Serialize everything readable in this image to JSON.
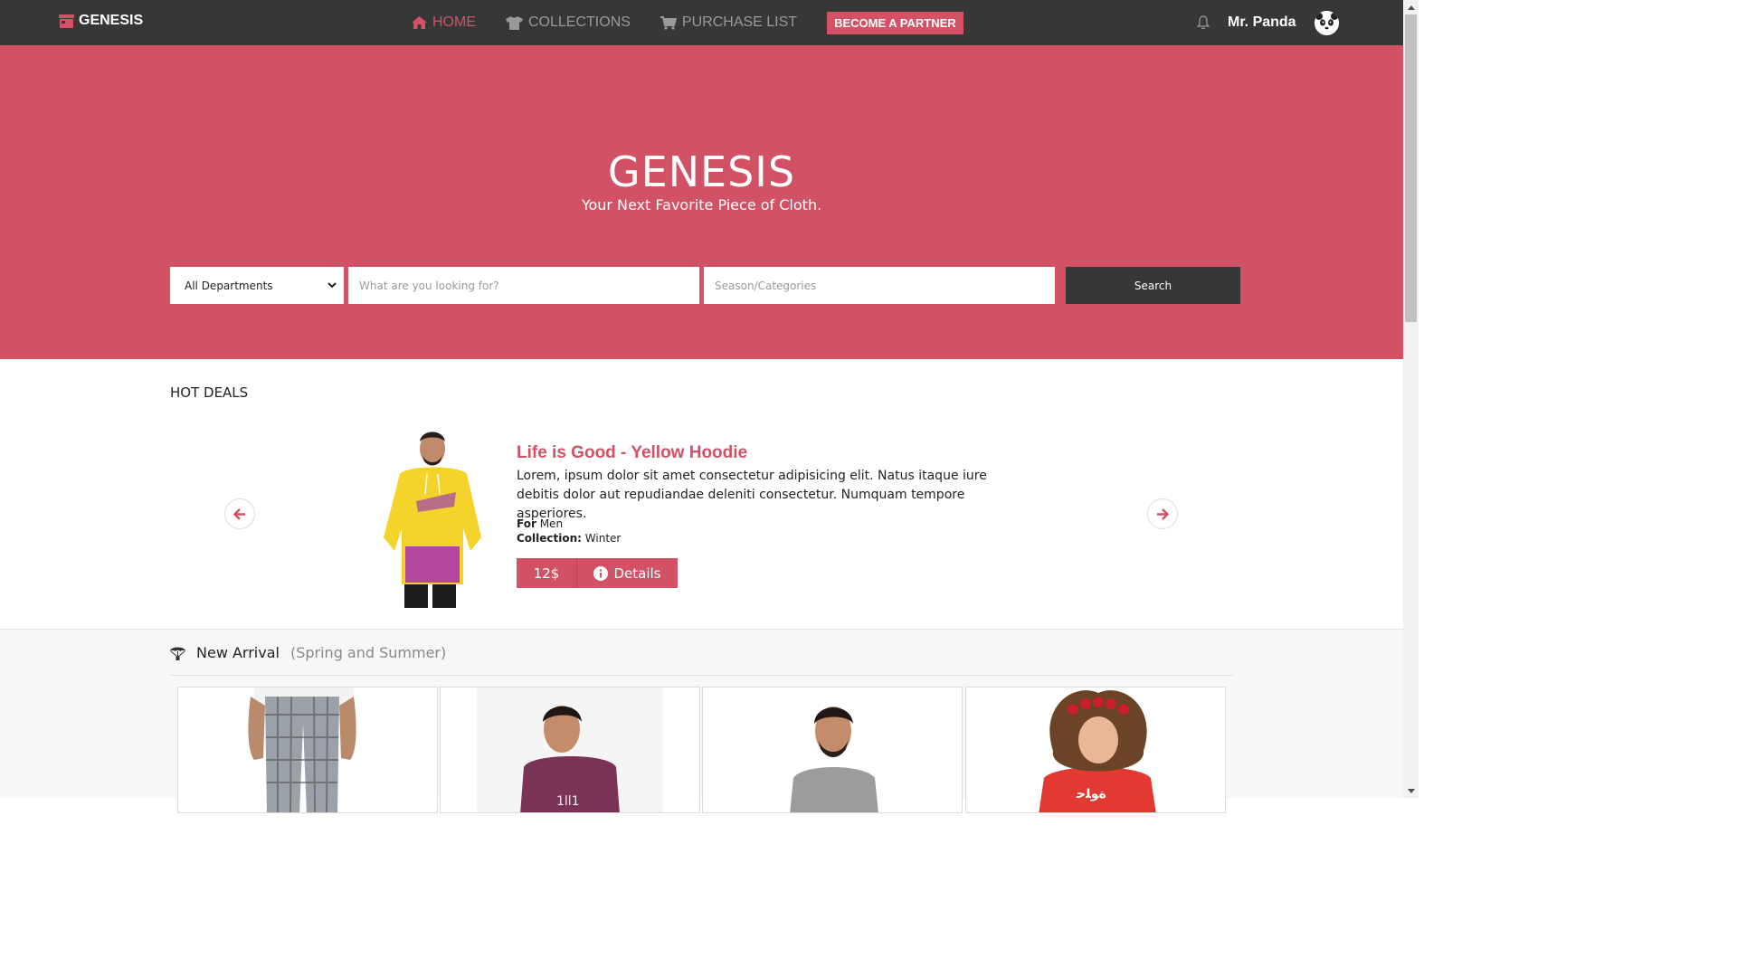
{
  "navbar": {
    "brand": "GENESIS",
    "links": [
      {
        "label": "HOME",
        "icon": "home-icon",
        "active": true
      },
      {
        "label": "COLLECTIONS",
        "icon": "shirt-icon",
        "active": false
      },
      {
        "label": "PURCHASE LIST",
        "icon": "cart-icon",
        "active": false
      }
    ],
    "partner_label": "BECOME A PARTNER",
    "user_name": "Mr. Panda",
    "avatar_icon": "panda-avatar"
  },
  "hero": {
    "title": "GENESIS",
    "subtitle": "Your Next Favorite Piece of Cloth."
  },
  "search": {
    "department_selected": "All Departments",
    "query_placeholder": "What are you looking for?",
    "category_placeholder": "Season/Categories",
    "button_label": "Search"
  },
  "hot_deals": {
    "title": "HOT DEALS",
    "item": {
      "name": "Life is Good - Yellow Hoodie",
      "description": "Lorem, ipsum dolor sit amet consectetur adipisicing elit. Natus itaque iure debitis dolor aut repudiandae deleniti consectetur. Numquam tempore asperiores.",
      "for_label": "For",
      "for_value": "Men",
      "collection_label": "Collection:",
      "collection_value": "Winter",
      "price": "12$",
      "details_label": "Details"
    }
  },
  "new_arrival": {
    "title": "New Arrival",
    "subtitle": "(Spring and Summer)"
  },
  "colors": {
    "accent": "#d15264",
    "dark": "#373737"
  }
}
